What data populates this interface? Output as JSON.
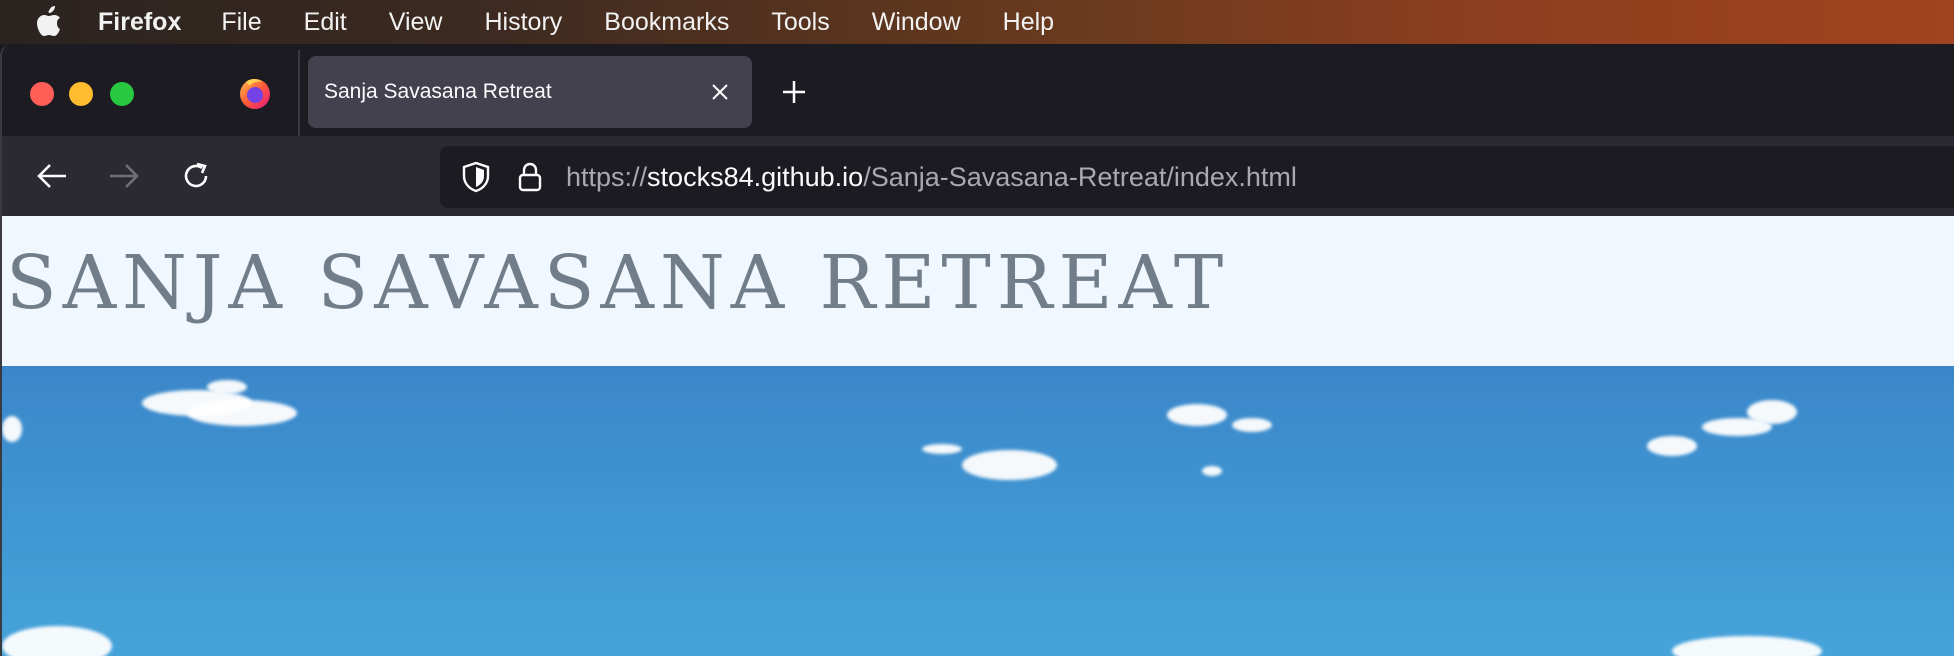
{
  "menubar": {
    "app_name": "Firefox",
    "items": [
      "File",
      "Edit",
      "View",
      "History",
      "Bookmarks",
      "Tools",
      "Window",
      "Help"
    ]
  },
  "tab": {
    "title": "Sanja Savasana Retreat"
  },
  "urlbar": {
    "scheme": "https://",
    "host": "stocks84.github.io",
    "path": "/Sanja-Savasana-Retreat/index.html"
  },
  "page": {
    "site_title": "SANJA SAVASANA RETREAT"
  },
  "colors": {
    "title_color": "#717e89",
    "page_bg": "#f0f7ff",
    "sky": "#3f94d1"
  }
}
